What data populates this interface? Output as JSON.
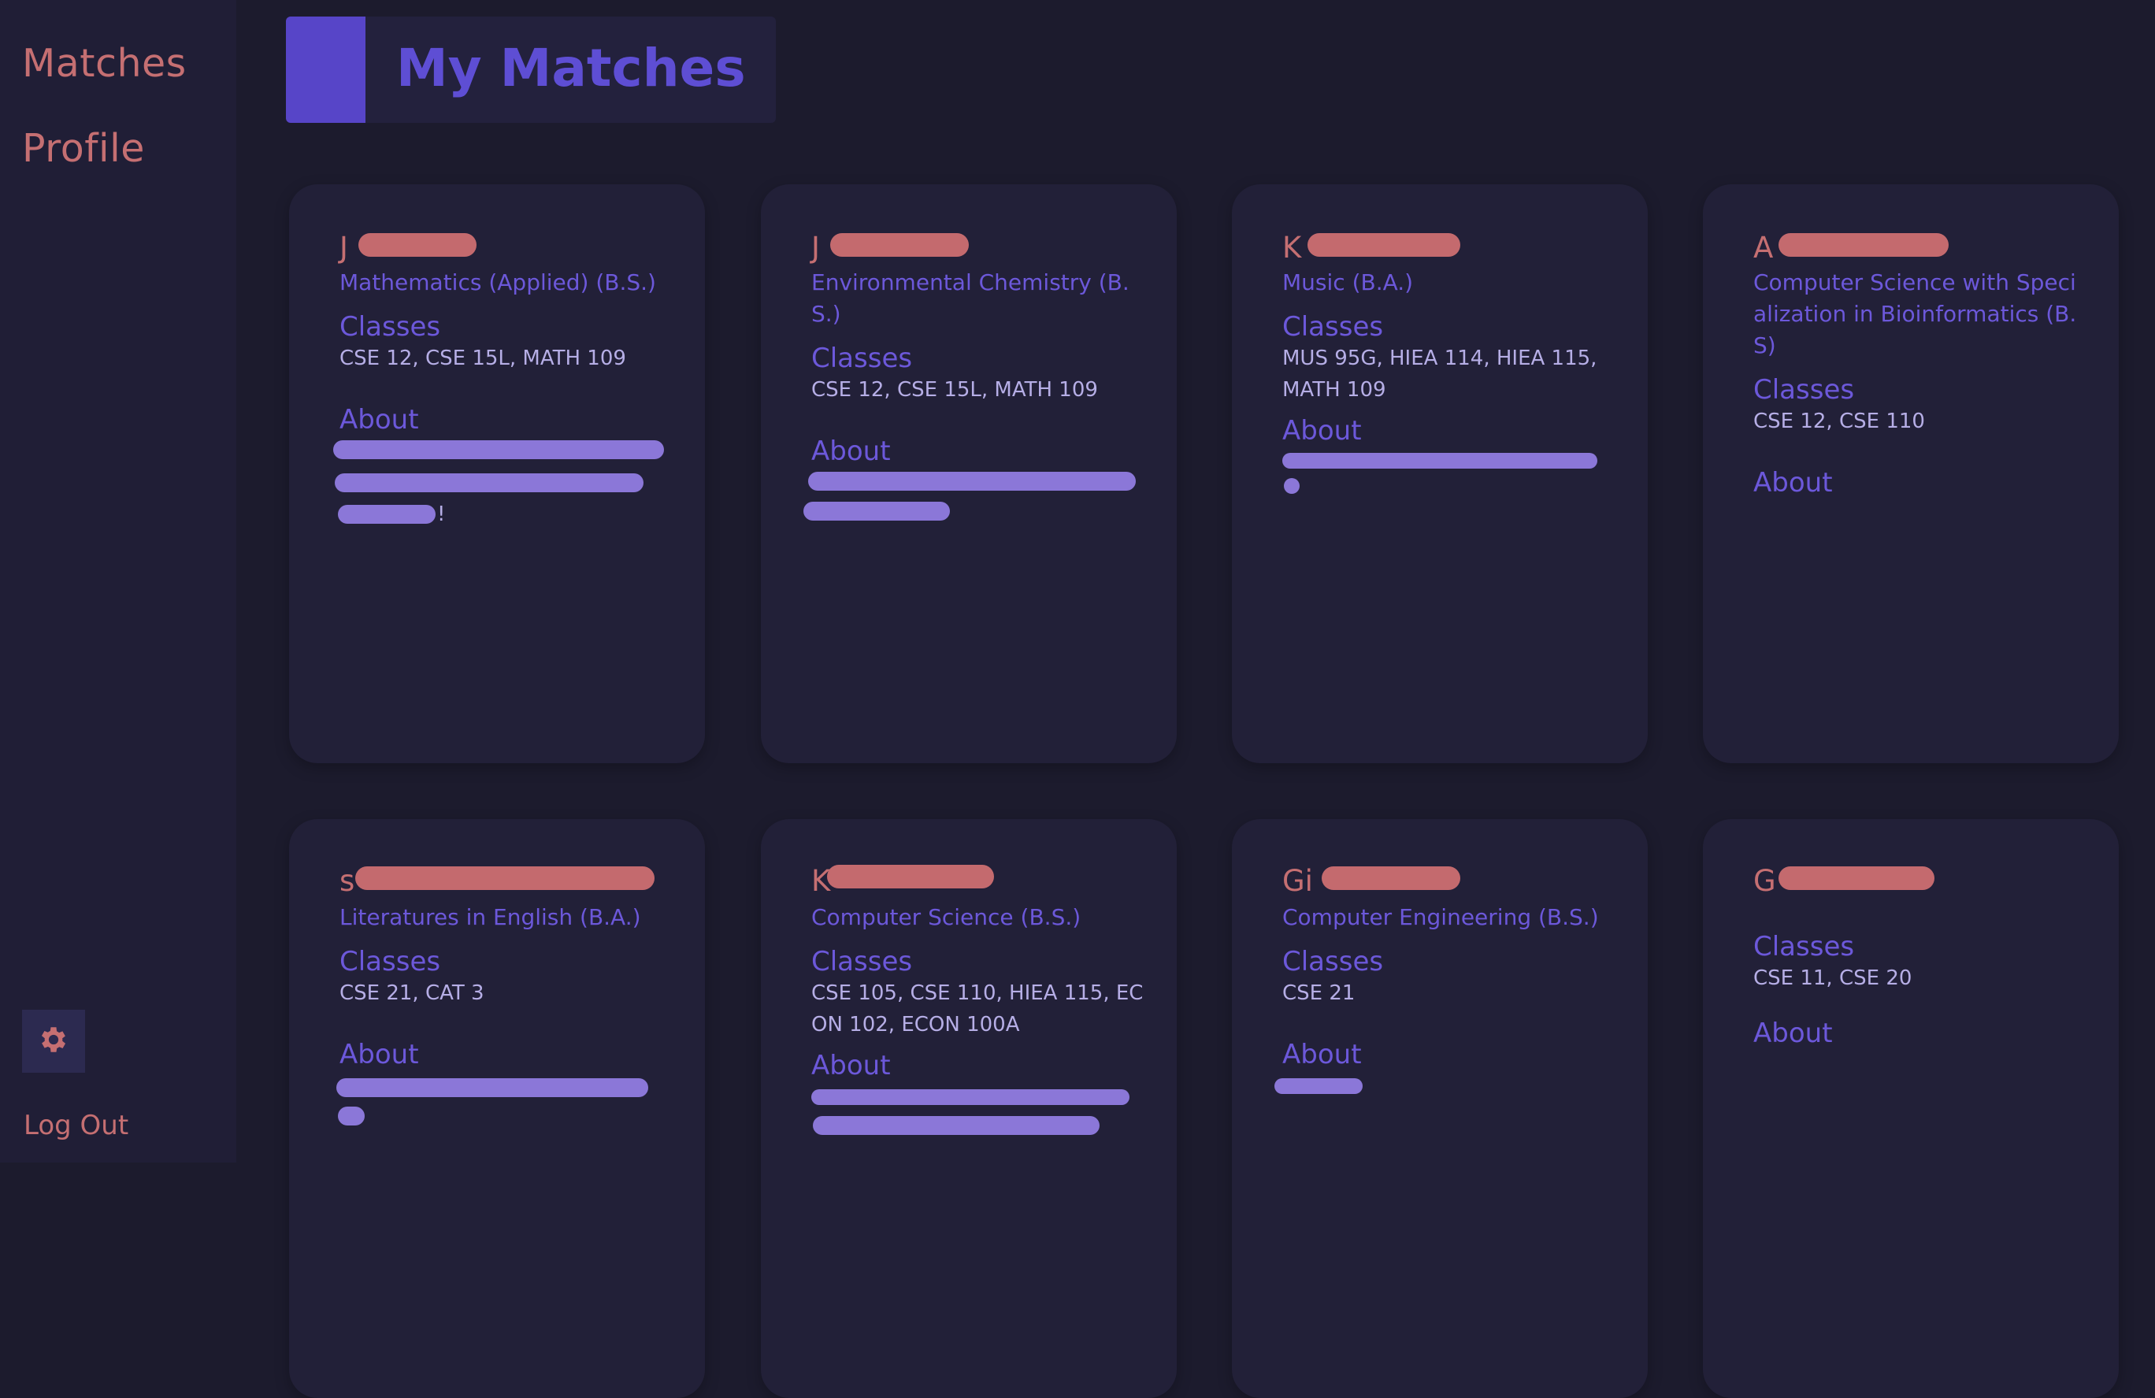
{
  "sidebar": {
    "nav": [
      {
        "label": "Matches"
      },
      {
        "label": "Profile"
      }
    ],
    "settings_icon": "gear-icon",
    "logout_label": "Log Out"
  },
  "header": {
    "title": "My Matches"
  },
  "labels": {
    "classes": "Classes",
    "about": "About"
  },
  "colors": {
    "background": "#1c1b2d",
    "sidebar": "#201e36",
    "card": "#222038",
    "accent_purple": "#5745c8",
    "nav_text": "#c56f72",
    "body_text": "#b6aee6"
  },
  "matches": [
    {
      "name_visible": "J",
      "major": "Mathematics (Applied) (B.S.)",
      "classes": "CSE 12, CSE 15L, MATH 109",
      "about_visible": "!"
    },
    {
      "name_visible": "J",
      "major": "Environmental Chemistry (B.S.)",
      "classes": "CSE 12, CSE 15L, MATH 109",
      "about_visible": ""
    },
    {
      "name_visible": "K",
      "major": "Music (B.A.)",
      "classes": "MUS 95G, HIEA 114, HIEA 115, MATH 109",
      "about_visible": ""
    },
    {
      "name_visible": "A",
      "major": "Computer Science with Specialization in Bioinformatics (B.S)",
      "classes": "CSE 12, CSE 110",
      "about_visible": ""
    },
    {
      "name_visible": "s",
      "major": "Literatures in English (B.A.)",
      "classes": "CSE 21, CAT 3",
      "about_visible": ""
    },
    {
      "name_visible": "K",
      "major": "Computer Science (B.S.)",
      "classes": "CSE 105, CSE 110, HIEA 115, ECON 102, ECON 100A",
      "about_visible": ""
    },
    {
      "name_visible": "Gi",
      "major": "Computer Engineering (B.S.)",
      "classes": "CSE 21",
      "about_visible": ""
    },
    {
      "name_visible": "G",
      "major": "",
      "classes": "CSE 11, CSE 20",
      "about_visible": ""
    }
  ]
}
